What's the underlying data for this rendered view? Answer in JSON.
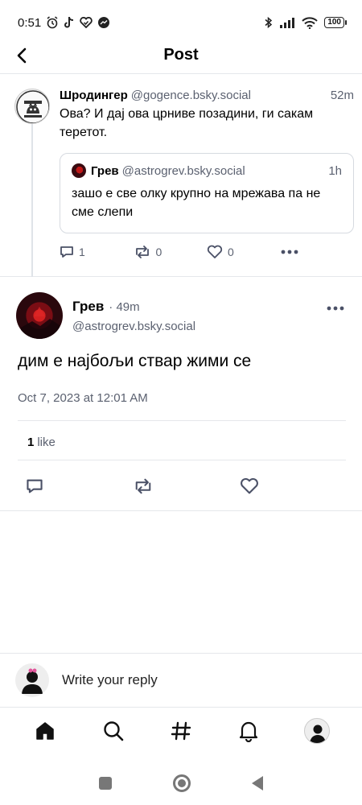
{
  "status_bar": {
    "time": "0:51",
    "battery": "100"
  },
  "header": {
    "title": "Post"
  },
  "parent_post": {
    "author_name": "Шродингер",
    "author_handle": "@gogence.bsky.social",
    "time": "52m",
    "text": "Ова? И дај ова црниве позадини, ги сакам теретот.",
    "quote": {
      "author_name": "Грев",
      "author_handle": "@astrogrev.bsky.social",
      "time": "1h",
      "text": "зашо е све олку крупно на мрежава па не сме слепи"
    },
    "actions": {
      "reply_count": "1",
      "repost_count": "0",
      "like_count": "0"
    }
  },
  "main_post": {
    "author_name": "Грев",
    "time": "· 49m",
    "author_handle": "@astrogrev.bsky.social",
    "text": "дим е најбољи ствар жими се",
    "date": "Oct 7, 2023 at 12:01 AM",
    "like_count": "1",
    "like_label": "like"
  },
  "reply_bar": {
    "placeholder": "Write your reply"
  },
  "colors": {
    "muted_text": "#5b6170",
    "divider": "#e5e7eb",
    "icon": "#4a5066"
  },
  "icons": {
    "status_left": [
      "alarm-icon",
      "tiktok-icon",
      "heart-check-icon",
      "messenger-icon"
    ],
    "status_right": [
      "bluetooth-icon",
      "signal-icon",
      "wifi-icon",
      "battery-icon"
    ],
    "nav": [
      "home-icon",
      "search-icon",
      "hashtag-icon",
      "bell-icon",
      "profile-avatar"
    ]
  }
}
